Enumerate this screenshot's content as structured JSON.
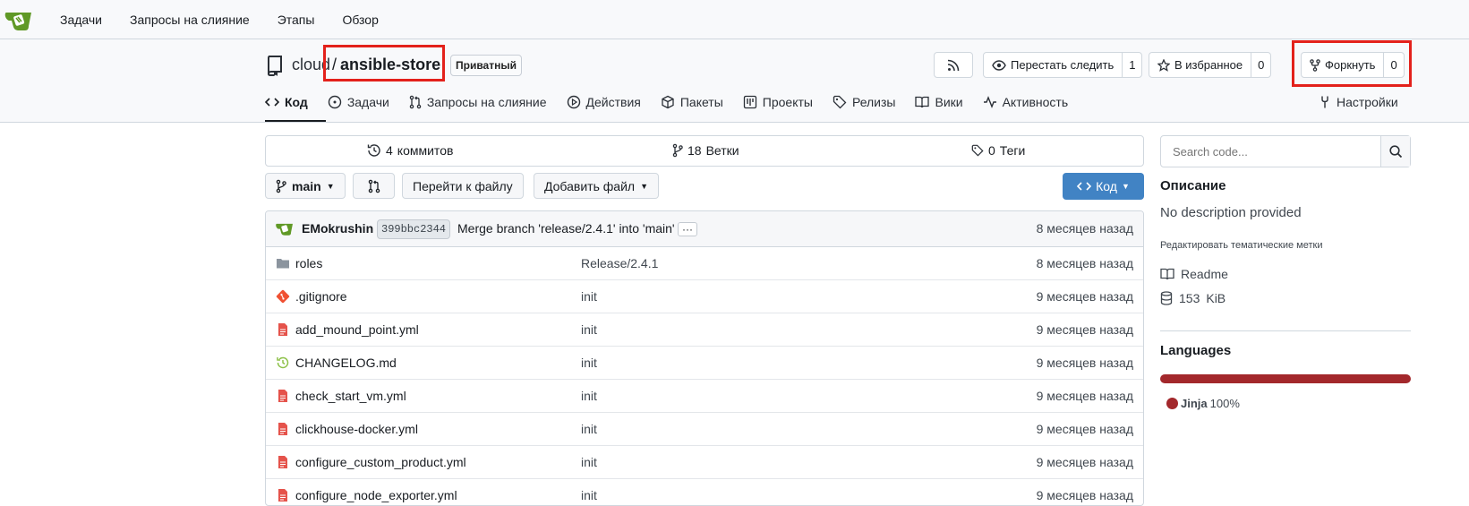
{
  "topnav": [
    "Задачи",
    "Запросы на слияние",
    "Этапы",
    "Обзор"
  ],
  "repo": {
    "owner": "cloud",
    "separator": "/",
    "name": "ansible-store",
    "private_label": "Приватный"
  },
  "actions": {
    "unwatch_label": "Перестать следить",
    "unwatch_count": "1",
    "star_label": "В избранное",
    "star_count": "0",
    "fork_label": "Форкнуть",
    "fork_count": "0"
  },
  "tabs": [
    "Код",
    "Задачи",
    "Запросы на слияние",
    "Действия",
    "Пакеты",
    "Проекты",
    "Релизы",
    "Вики",
    "Активность"
  ],
  "settings_label": "Настройки",
  "stats": {
    "commits_count": "4",
    "commits_label": "коммитов",
    "branches_count": "18",
    "branches_label": "Ветки",
    "tags_count": "0",
    "tags_label": "Теги"
  },
  "controls": {
    "branch": "main",
    "goto_file": "Перейти к файлу",
    "add_file": "Добавить файл",
    "code_button": "Код"
  },
  "commit": {
    "author": "EMokrushin",
    "sha": "399bbc2344",
    "message": "Merge branch 'release/2.4.1' into 'main'",
    "ellipsis": "···",
    "time": "8 месяцев назад"
  },
  "files": [
    {
      "name": "roles",
      "type": "folder",
      "message": "Release/2.4.1",
      "time": "8 месяцев назад"
    },
    {
      "name": ".gitignore",
      "type": "git",
      "message": "init",
      "time": "9 месяцев назад"
    },
    {
      "name": "add_mound_point.yml",
      "type": "file",
      "message": "init",
      "time": "9 месяцев назад"
    },
    {
      "name": "CHANGELOG.md",
      "type": "history",
      "message": "init",
      "time": "9 месяцев назад"
    },
    {
      "name": "check_start_vm.yml",
      "type": "file",
      "message": "init",
      "time": "9 месяцев назад"
    },
    {
      "name": "clickhouse-docker.yml",
      "type": "file",
      "message": "init",
      "time": "9 месяцев назад"
    },
    {
      "name": "configure_custom_product.yml",
      "type": "file",
      "message": "init",
      "time": "9 месяцев назад"
    },
    {
      "name": "configure_node_exporter.yml",
      "type": "file",
      "message": "init",
      "time": "9 месяцев назад"
    }
  ],
  "sidebar": {
    "search_placeholder": "Search code...",
    "description_title": "Описание",
    "description_text": "No description provided",
    "edit_topics": "Редактировать тематические метки",
    "readme": "Readme",
    "size_value": "153",
    "size_unit": "KiB",
    "languages_title": "Languages",
    "lang_name": "Jinja",
    "lang_percent": "100%",
    "lang_fraction": 1.0,
    "lang_color": "#a3282c"
  },
  "colors": {
    "accent": "#4183c4",
    "highlight": "#e3211b",
    "yaml_icon": "#e5534b",
    "git_icon": "#f05133"
  }
}
